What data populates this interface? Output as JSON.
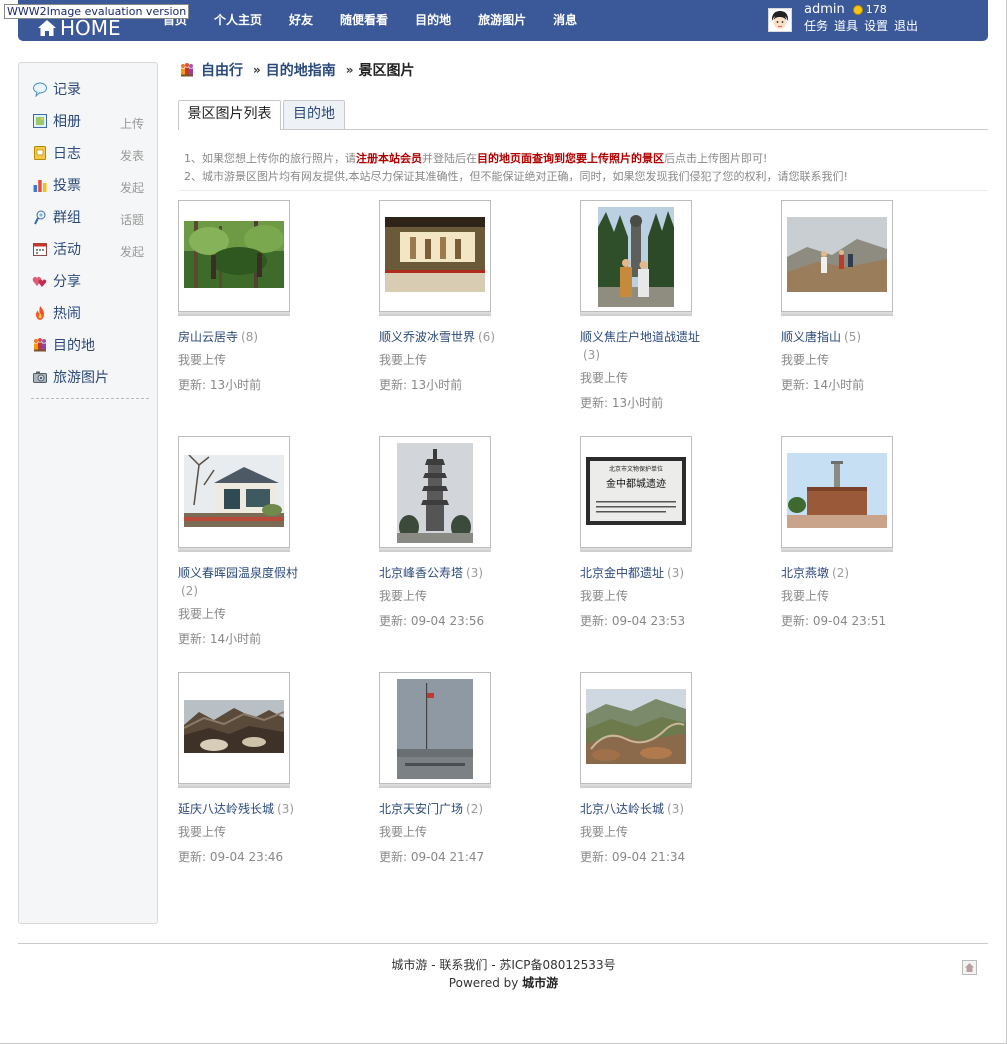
{
  "watermark": "WWW2Image evaluation version",
  "header": {
    "logo_text": "HOME",
    "nav": [
      "首页",
      "个人主页",
      "好友",
      "随便看看",
      "目的地",
      "旅游图片",
      "消息"
    ],
    "user": {
      "name": "admin",
      "credits": "178",
      "links": [
        "任务",
        "道具",
        "设置",
        "退出"
      ]
    }
  },
  "sidebar": {
    "items": [
      {
        "label": "记录",
        "action": "",
        "icon": "speech-bubble-icon"
      },
      {
        "label": "相册",
        "action": "上传",
        "icon": "photo-album-icon"
      },
      {
        "label": "日志",
        "action": "发表",
        "icon": "journal-icon"
      },
      {
        "label": "投票",
        "action": "发起",
        "icon": "bar-chart-icon"
      },
      {
        "label": "群组",
        "action": "话题",
        "icon": "group-icon"
      },
      {
        "label": "活动",
        "action": "发起",
        "icon": "calendar-icon"
      },
      {
        "label": "分享",
        "action": "",
        "icon": "hearts-icon"
      },
      {
        "label": "热闹",
        "action": "",
        "icon": "flame-icon"
      },
      {
        "label": "目的地",
        "action": "",
        "icon": "travelers-icon"
      },
      {
        "label": "旅游图片",
        "action": "",
        "icon": "camera-icon"
      }
    ]
  },
  "breadcrumb": {
    "items": [
      "自由行",
      "目的地指南",
      "景区图片"
    ],
    "separator": "»"
  },
  "tabs": [
    "景区图片列表",
    "目的地"
  ],
  "notice": {
    "line1_a": "1、如果您想上传你的旅行照片，请",
    "line1_hl1": "注册本站会员",
    "line1_b": "并登陆后在",
    "line1_hl2": "目的地页面查询到您要上传照片的景区",
    "line1_c": "后点击上传图片即可!",
    "line2": "2、城市游景区图片均有网友提供,本站尽力保证其准确性，但不能保证绝对正确，同时，如果您发现我们侵犯了您的权利，请您联系我们!"
  },
  "gallery": {
    "upload_label": "我要上传",
    "time_prefix": "更新: ",
    "items": [
      {
        "title": "房山云居寺",
        "count": "(8)",
        "time": "13小时前"
      },
      {
        "title": "顺义乔波冰雪世界",
        "count": "(6)",
        "time": "13小时前"
      },
      {
        "title": "顺义焦庄户地道战遗址",
        "count": "(3)",
        "time": "13小时前"
      },
      {
        "title": "顺义唐指山",
        "count": "(5)",
        "time": "14小时前"
      },
      {
        "title": "顺义春晖园温泉度假村",
        "count": "(2)",
        "time": "14小时前"
      },
      {
        "title": "北京峰香公寿塔",
        "count": "(3)",
        "time": "09-04 23:56"
      },
      {
        "title": "北京金中都遗址",
        "count": "(3)",
        "time": "09-04 23:53"
      },
      {
        "title": "北京燕墩",
        "count": "(2)",
        "time": "09-04 23:51"
      },
      {
        "title": "延庆八达岭残长城",
        "count": "(3)",
        "time": "09-04 23:46"
      },
      {
        "title": "北京天安门广场",
        "count": "(2)",
        "time": "09-04 21:47"
      },
      {
        "title": "北京八达岭长城",
        "count": "(3)",
        "time": "09-04 21:34"
      }
    ]
  },
  "stele_text": [
    "北京市文物保护单位",
    "金中都城遗迹"
  ],
  "footer": {
    "line1": "城市游 - 联系我们 - 苏ICP备08012533号",
    "powered_prefix": "Powered by ",
    "powered_brand": "城市游"
  }
}
